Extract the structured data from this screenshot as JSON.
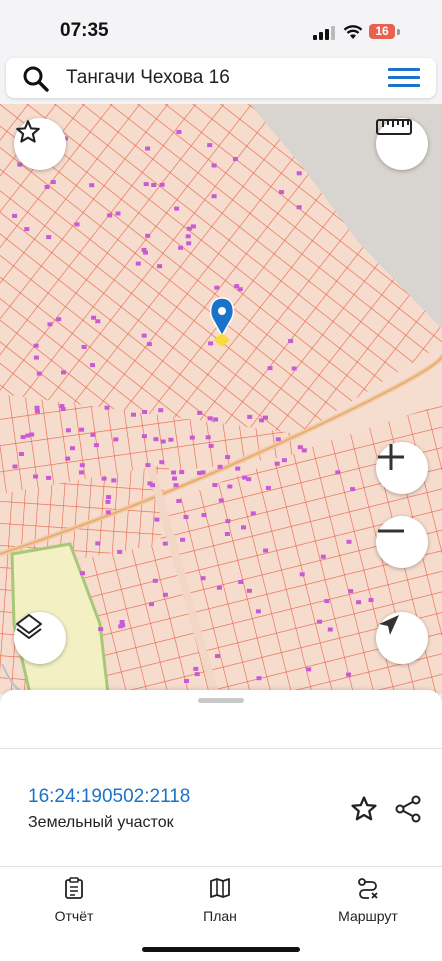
{
  "status": {
    "time": "07:35",
    "battery": "16"
  },
  "search": {
    "query": "Тангачи Чехова 16"
  },
  "map": {
    "controls": [
      "favorite-star-icon",
      "ruler-icon",
      "zoom-in-icon",
      "zoom-out-icon",
      "layers-icon",
      "locate-arrow-icon"
    ],
    "colors": {
      "parcel_fill": "#f5ddd0",
      "parcel_border": "#e8634a",
      "building": "#c85ad6",
      "pin": "#1a73c8",
      "field": "#f3f1c4",
      "empty": "#d8d4d0"
    }
  },
  "parcel": {
    "cadastral_number": "16:24:190502:2118",
    "type": "Земельный участок"
  },
  "tabbar": {
    "report_label": "Отчёт",
    "plan_label": "План",
    "route_label": "Маршрут"
  }
}
